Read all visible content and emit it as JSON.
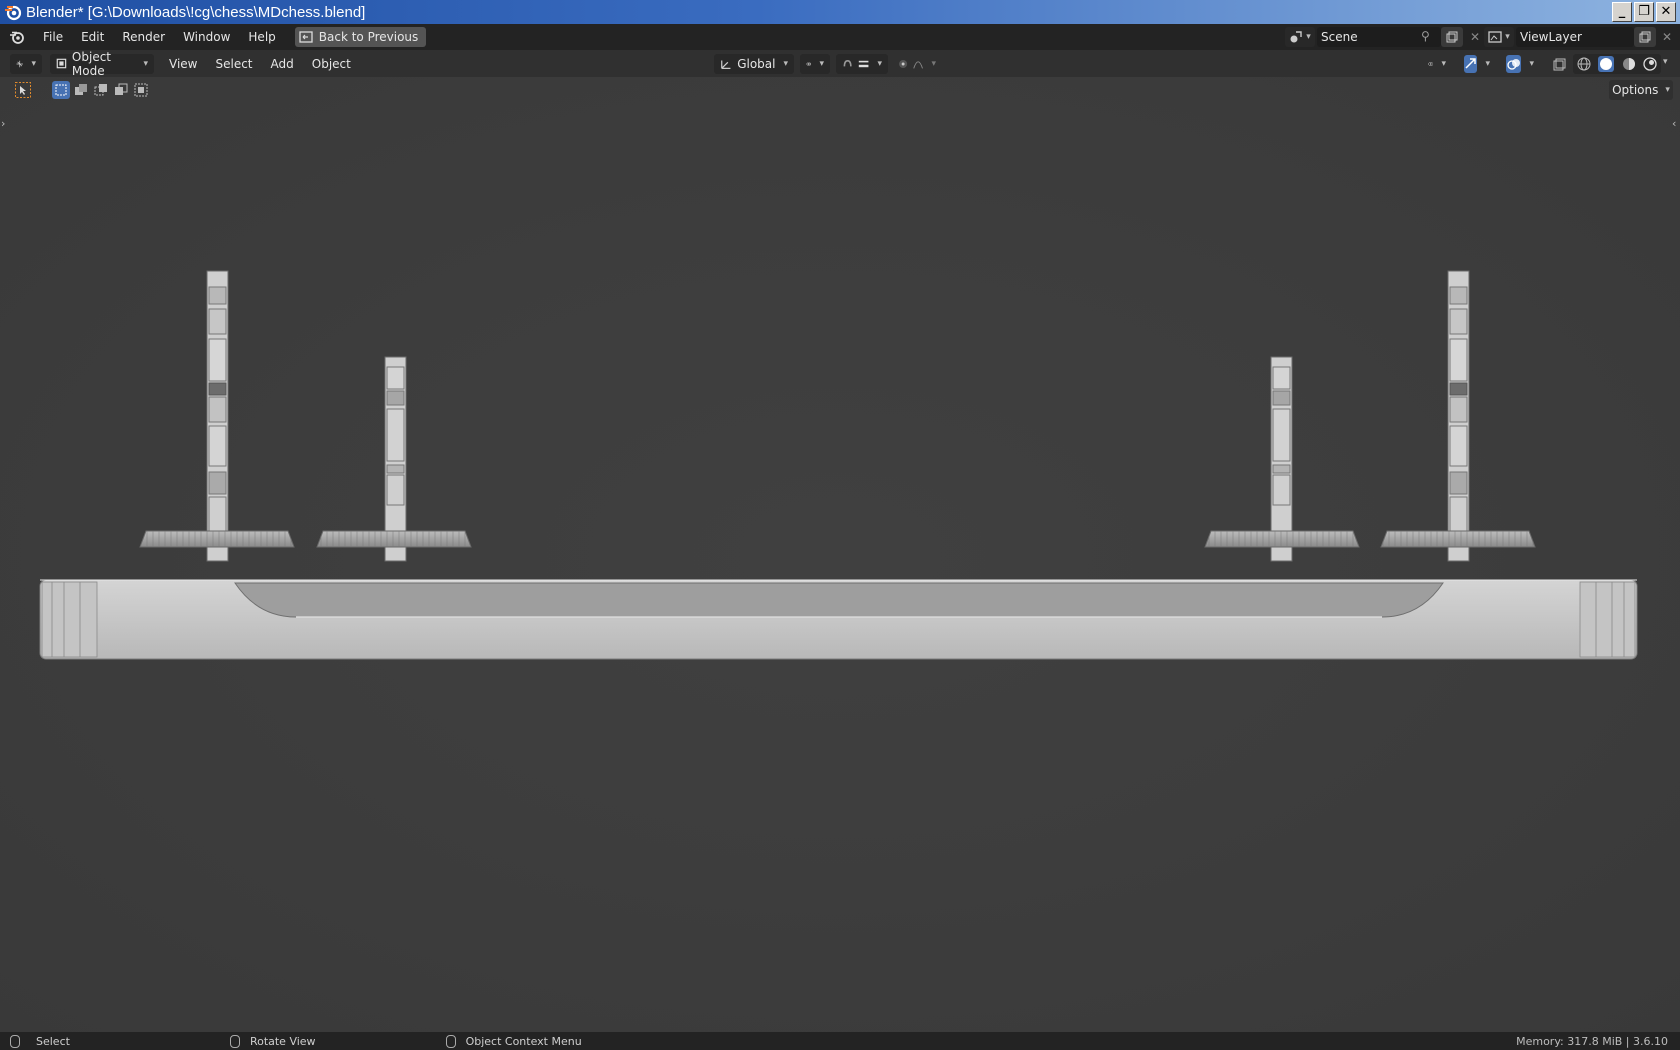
{
  "window": {
    "title": "Blender* [G:\\Downloads\\!cg\\chess\\MDchess.blend]",
    "controls": {
      "minimize": "_",
      "restore": "❐",
      "close": "✕"
    }
  },
  "menubar": {
    "items": [
      "File",
      "Edit",
      "Render",
      "Window",
      "Help"
    ],
    "back_label": "Back to Previous",
    "scene_label": "Scene",
    "viewlayer_label": "ViewLayer"
  },
  "header": {
    "mode_label": "Object Mode",
    "menus": [
      "View",
      "Select",
      "Add",
      "Object"
    ],
    "orientation_label": "Global",
    "options_label": "Options"
  },
  "statusbar": {
    "select_label": "Select",
    "rotate_label": "Rotate View",
    "context_label": "Object Context Menu",
    "memory_label": "Memory: 317.8 MiB | 3.6.10"
  },
  "colors": {
    "accent": "#4772b3",
    "viewport_bg": "#3d3d3d",
    "header_bg": "#303030",
    "topbar_bg": "#232323"
  },
  "icons": [
    "blender-logo-icon",
    "screen-icon",
    "editor-type-icon",
    "object-mode-icon",
    "transform-orientation-icon",
    "pivot-icon",
    "snap-icon",
    "proportional-edit-icon",
    "visibility-icon",
    "gizmo-icon",
    "overlay-icon",
    "xray-icon",
    "wireframe-shading-icon",
    "solid-shading-icon",
    "material-shading-icon",
    "rendered-shading-icon",
    "select-box-icon",
    "pin-icon",
    "copy-icon",
    "close-icon",
    "mouse-icon"
  ]
}
